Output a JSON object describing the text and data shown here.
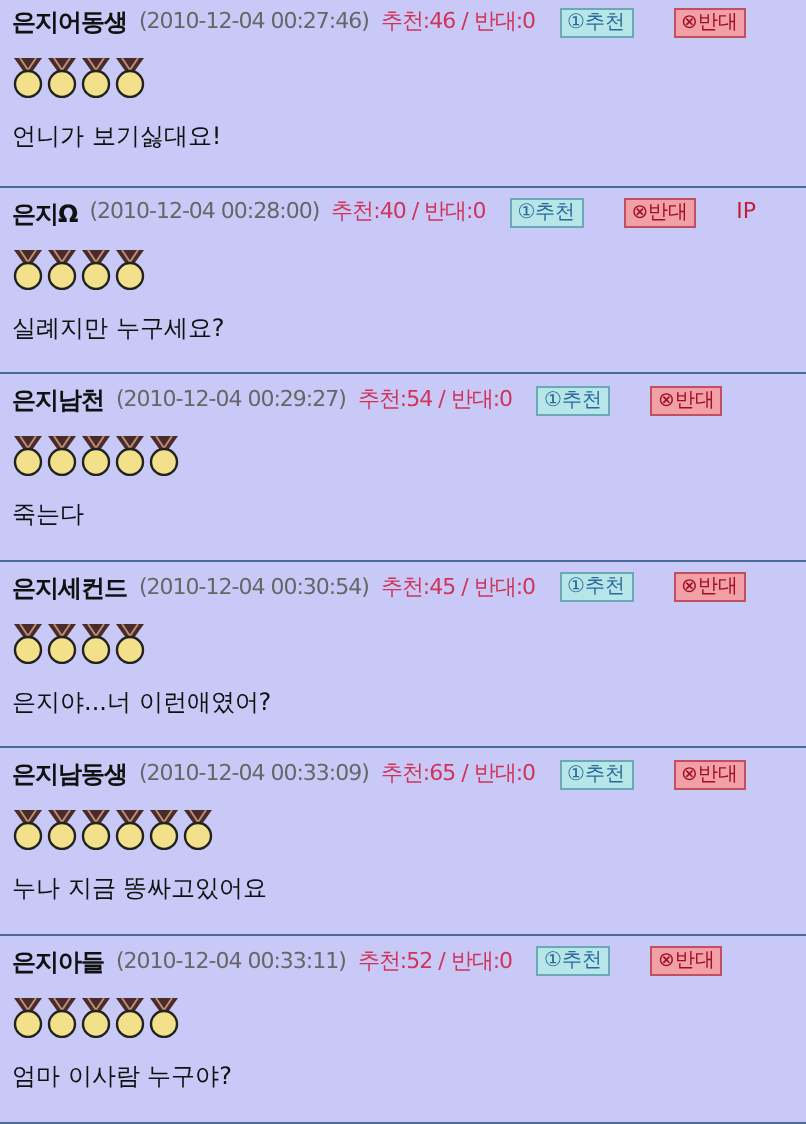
{
  "comments": [
    {
      "author": "은지어동생",
      "date": "(2010-12-04 00:27:46)",
      "votes": "추천:46 / 반대:0",
      "recommend": "①추천",
      "oppose": "⊗반대",
      "stars": 4,
      "text": "언니가 보기싫대요!"
    },
    {
      "author": "은지Ω",
      "date": "(2010-12-04 00:28:00)",
      "votes": "추천:40 / 반대:0",
      "recommend": "①추천",
      "oppose": "⊗반대",
      "ip_label": "IP",
      "stars": 4,
      "text": "실례지만 누구세요?"
    },
    {
      "author": "은지남천",
      "date": "(2010-12-04 00:29:27)",
      "votes": "추천:54 / 반대:0",
      "recommend": "①추천",
      "oppose": "⊗반대",
      "stars": 5,
      "text": "죽는다"
    },
    {
      "author": "은지세컨드",
      "date": "(2010-12-04 00:30:54)",
      "votes": "추천:45 / 반대:0",
      "recommend": "①추천",
      "oppose": "⊗반대",
      "stars": 4,
      "text": "은지야...너 이런애였어?"
    },
    {
      "author": "은지남동생",
      "date": "(2010-12-04 00:33:09)",
      "votes": "추천:65 / 반대:0",
      "recommend": "①추천",
      "oppose": "⊗반대",
      "stars": 6,
      "text": "누나 지금 똥싸고있어요"
    },
    {
      "author": "은지아들",
      "date": "(2010-12-04 00:33:11)",
      "votes": "추천:52 / 반대:0",
      "recommend": "①추천",
      "oppose": "⊗반대",
      "stars": 5,
      "text": "엄마 이사람 누구야?"
    }
  ]
}
